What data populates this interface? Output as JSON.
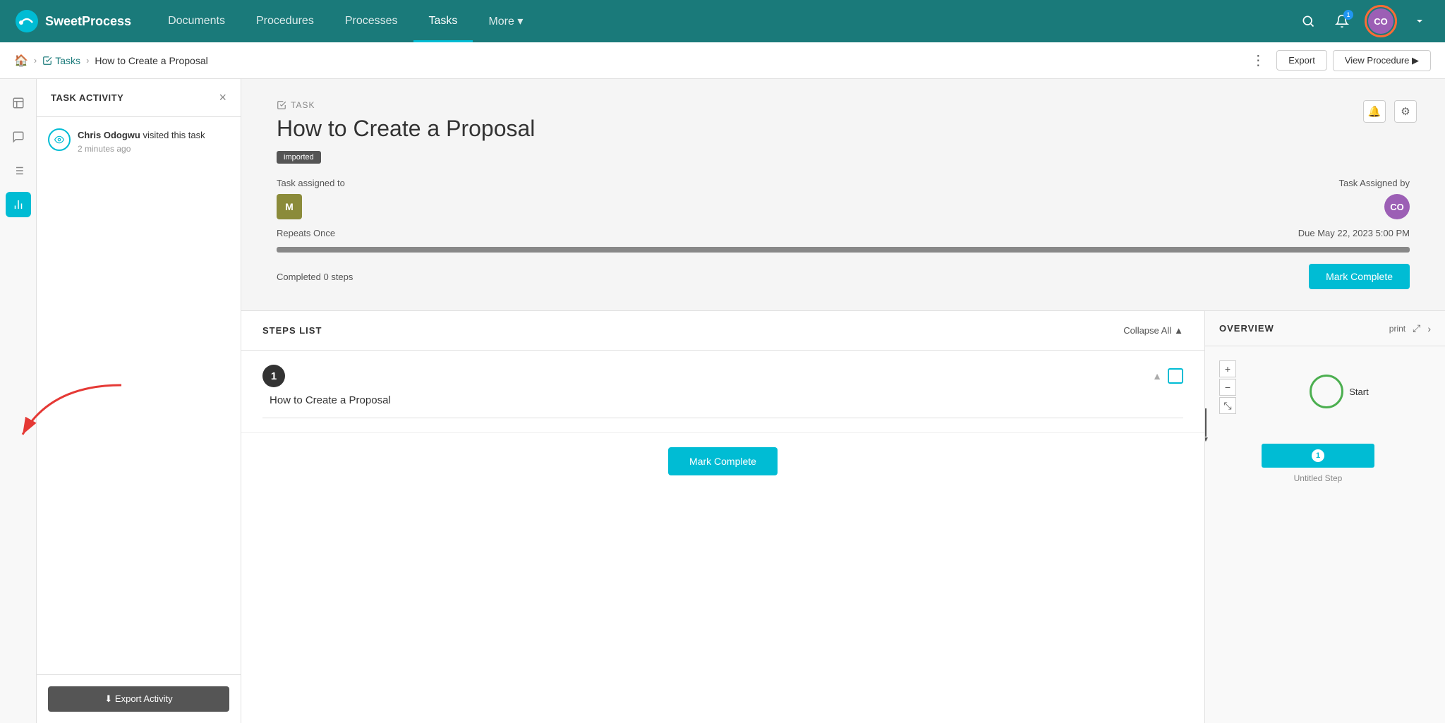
{
  "app": {
    "logo_text": "SweetProcess"
  },
  "nav": {
    "items": [
      {
        "label": "Documents",
        "active": false
      },
      {
        "label": "Procedures",
        "active": false
      },
      {
        "label": "Processes",
        "active": false
      },
      {
        "label": "Tasks",
        "active": true
      },
      {
        "label": "More",
        "active": false,
        "has_arrow": true
      }
    ]
  },
  "breadcrumb": {
    "home_icon": "🏠",
    "tasks_label": "Tasks",
    "current": "How to Create a Proposal",
    "export_label": "Export",
    "view_procedure_label": "View Procedure ▶"
  },
  "activity_panel": {
    "title": "TASK ACTIVITY",
    "close_label": "×",
    "items": [
      {
        "user": "Chris Odogwu",
        "action": " visited this task",
        "time": "2 minutes ago"
      }
    ],
    "export_button_label": "⬇ Export Activity"
  },
  "task": {
    "label": "TASK",
    "title": "How to Create a Proposal",
    "badge": "imported",
    "assigned_to_label": "Task assigned to",
    "assignee_initials": "M",
    "assigned_by_label": "Task Assigned by",
    "assigner_initials": "CO",
    "repeats_label": "Repeats Once",
    "due_date": "Due May 22, 2023 5:00 PM",
    "progress_percent": 0,
    "completed_steps_label": "Completed 0 steps",
    "mark_complete_label": "Mark Complete"
  },
  "steps": {
    "title": "STEPS LIST",
    "collapse_all_label": "Collapse All",
    "items": [
      {
        "number": "1",
        "name": "How to Create a Proposal"
      }
    ],
    "mark_complete_label": "Mark Complete"
  },
  "overview": {
    "title": "OVERVIEW",
    "print_label": "print",
    "start_label": "Start",
    "step_label": "1",
    "untitled_label": "Untitled Step"
  }
}
